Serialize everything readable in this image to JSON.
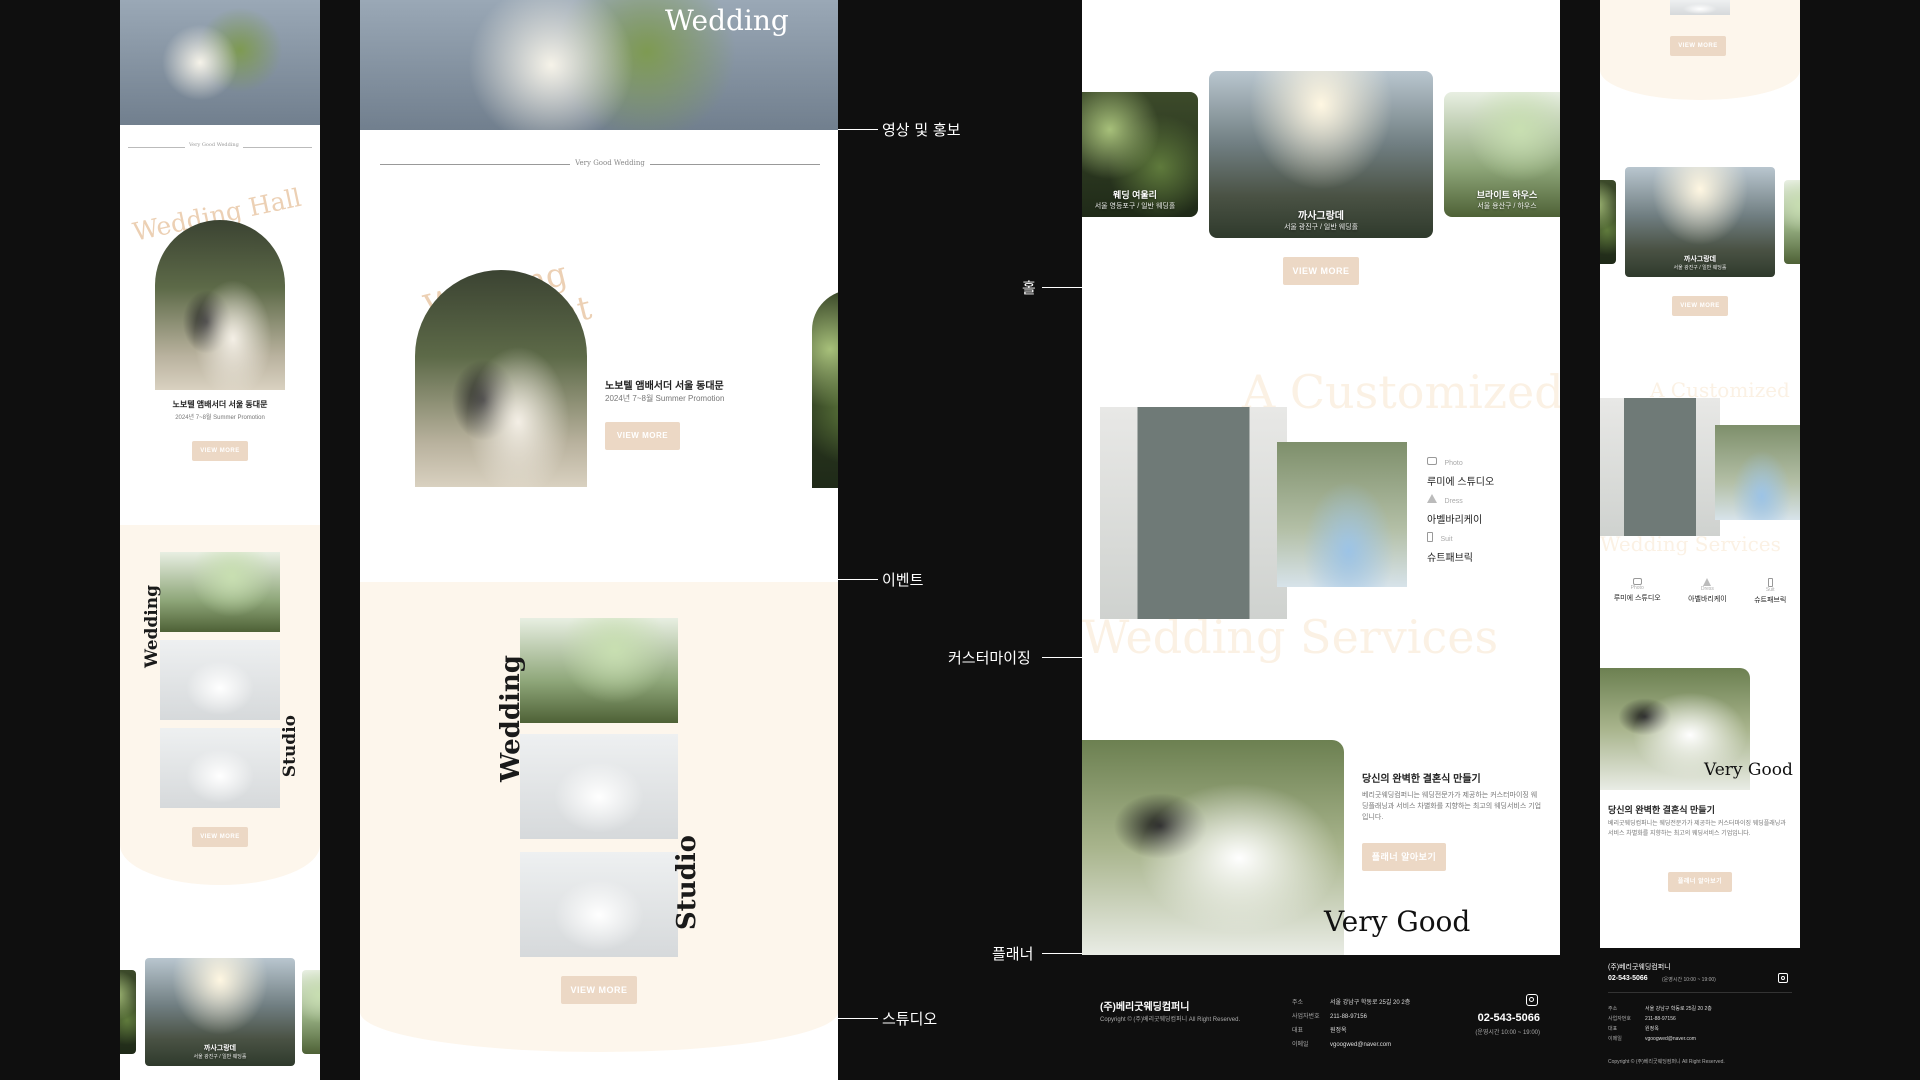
{
  "labels": {
    "promo": "영상 및 홍보",
    "hall": "홀",
    "event": "이벤트",
    "customizing": "커스터마이징",
    "planner": "플래너",
    "studio": "스튜디오"
  },
  "hero": {
    "title": "Wedding"
  },
  "event": {
    "eyebrow": "Very Good Wedding",
    "arc_text": "Wedding Hall Event",
    "venue": "노보텔 앰배서더 서울 동대문",
    "promo": "2024년 7~8월 Summer Promotion",
    "button": "VIEW MORE"
  },
  "studio": {
    "word_left": "Wedding",
    "word_right": "Studio",
    "button": "VIEW MORE"
  },
  "hall": {
    "button": "VIEW MORE",
    "cards": [
      {
        "name": "웨딩 여울리",
        "sub": "서울 영등포구 / 일반 웨딩홀"
      },
      {
        "name": "까사그랑데",
        "sub": "서울 광진구 / 일반 웨딩홀"
      },
      {
        "name": "브라이트 하우스",
        "sub": "서울 용산구 / 하우스"
      }
    ]
  },
  "custom": {
    "bg_top": "A Customized",
    "bg_bottom": "Wedding Services",
    "items": [
      {
        "icon": "camera-icon",
        "type": "Photo",
        "name": "루미에 스튜디오"
      },
      {
        "icon": "dress-icon",
        "type": "Dress",
        "name": "아벨바리케이"
      },
      {
        "icon": "suit-icon",
        "type": "Suit",
        "name": "슈트패브릭"
      }
    ]
  },
  "planner": {
    "overlay": "Very Good",
    "heading": "당신의 완벽한 결혼식 만들기",
    "body": "베리굿웨딩컴퍼니는 웨딩전문가가 제공하는 커스터마이징 웨딩플래닝과 서비스 차별화를 지향하는 최고의 웨딩서비스 기업입니다.",
    "button": "플래너 알아보기"
  },
  "footer": {
    "company": "(주)베리굿웨딩컴퍼니",
    "copyright": "Copyright © (주)베리굿웨딩컴퍼니 All Right Reserved.",
    "rows": [
      {
        "k": "주소",
        "v": "서울 강남구 학동로 25길 20 2층"
      },
      {
        "k": "사업자번호",
        "v": "211-88-97156"
      },
      {
        "k": "대표",
        "v": "원정옥"
      },
      {
        "k": "이메일",
        "v": "vgoogwed@naver.com"
      }
    ],
    "phone": "02-543-5066",
    "hours": "(운영시간 10:00 ~ 19:00)"
  },
  "colors": {
    "accent": "#ecd8c5",
    "cream": "#fdf6ec",
    "dark": "#0f0f0f"
  }
}
